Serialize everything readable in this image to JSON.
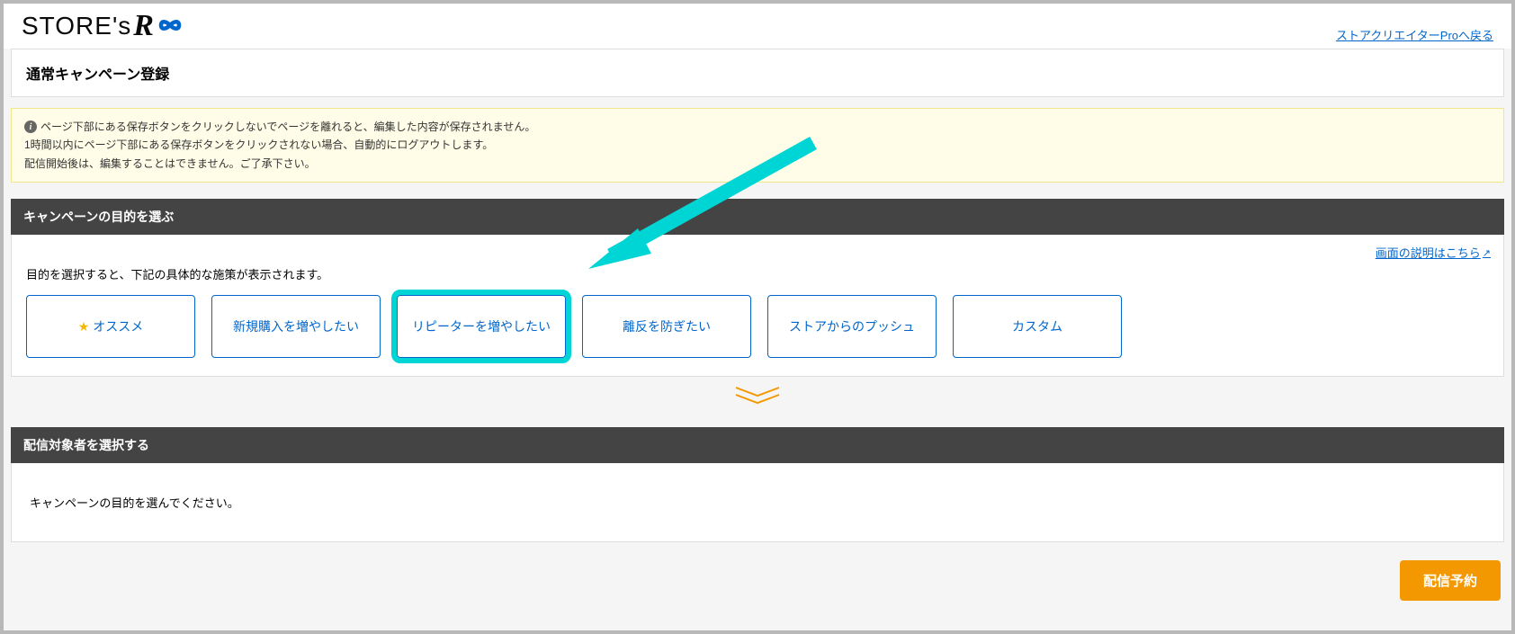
{
  "header": {
    "logo_text": "STORE's",
    "logo_r": "R",
    "back_link": "ストアクリエイターProへ戻る"
  },
  "page_title": "通常キャンペーン登録",
  "warning": {
    "line1": "ページ下部にある保存ボタンをクリックしないでページを離れると、編集した内容が保存されません。",
    "line2": "1時間以内にページ下部にある保存ボタンをクリックされない場合、自動的にログアウトします。",
    "line3": "配信開始後は、編集することはできません。ご了承下さい。"
  },
  "section1": {
    "title": "キャンペーンの目的を選ぶ",
    "help_link": "画面の説明はこちら",
    "description": "目的を選択すると、下記の具体的な施策が表示されます。",
    "options": [
      {
        "label": "オススメ",
        "star": true,
        "highlighted": false
      },
      {
        "label": "新規購入を増やしたい",
        "star": false,
        "highlighted": false
      },
      {
        "label": "リピーターを増やしたい",
        "star": false,
        "highlighted": true
      },
      {
        "label": "離反を防ぎたい",
        "star": false,
        "highlighted": false
      },
      {
        "label": "ストアからのプッシュ",
        "star": false,
        "highlighted": false
      },
      {
        "label": "カスタム",
        "star": false,
        "highlighted": false
      }
    ]
  },
  "section2": {
    "title": "配信対象者を選択する",
    "body_text": "キャンペーンの目的を選んでください。"
  },
  "footer": {
    "submit_button": "配信予約"
  }
}
